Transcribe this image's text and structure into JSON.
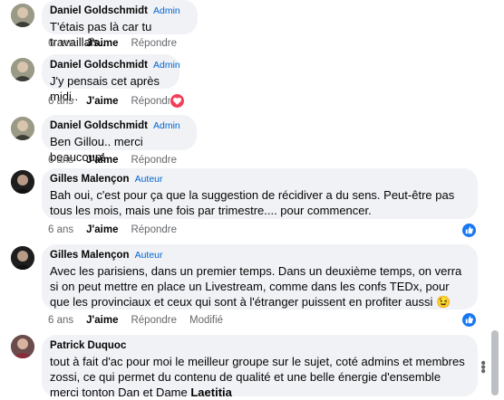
{
  "comments": [
    {
      "author": "Daniel Goldschmidt",
      "badge": "Admin",
      "text": "T'étais pas là car tu travaillais..",
      "time": "6 ans",
      "like": "J'aime",
      "reply": "Répondre",
      "edited": "",
      "reaction": ""
    },
    {
      "author": "Daniel Goldschmidt",
      "badge": "Admin",
      "text": "J'y pensais cet après midi..",
      "time": "6 ans",
      "like": "J'aime",
      "reply": "Répondre",
      "edited": "",
      "reaction": "love-icon"
    },
    {
      "author": "Daniel Goldschmidt",
      "badge": "Admin",
      "text": "Ben Gillou.. merci beaucoup!",
      "time": "6 ans",
      "like": "J'aime",
      "reply": "Répondre",
      "edited": "",
      "reaction": ""
    },
    {
      "author": "Gilles Malençon",
      "badge": "Auteur",
      "text": "Bah oui, c'est pour ça que la suggestion de récidiver a du sens. Peut-être pas tous les mois, mais une fois par trimestre.... pour commencer.",
      "time": "6 ans",
      "like": "J'aime",
      "reply": "Répondre",
      "edited": "",
      "reaction": "like-icon"
    },
    {
      "author": "Gilles Malençon",
      "badge": "Auteur",
      "text": "Avec les parisiens, dans un premier temps. Dans un deuxième temps, on verra si on peut mettre en place un Livestream, comme dans les confs TEDx, pour que les provinciaux et ceux qui sont à l'étranger puissent en profiter aussi 😉",
      "time": "6 ans",
      "like": "J'aime",
      "reply": "Répondre",
      "edited": "Modifié",
      "reaction": "like-icon"
    },
    {
      "author": "Patrick Duquoc",
      "badge": "",
      "text": "tout à fait d'ac pour moi le meilleur groupe sur le sujet, coté admins et membres zossi, ce qui permet du contenu de qualité et une belle énergie d'ensemble merci tonton Dan et Dame",
      "mention": "Laetitia",
      "time": "",
      "like": "",
      "reply": "",
      "edited": "",
      "reaction": ""
    }
  ],
  "colors": {
    "bubble": "#f0f2f5",
    "badge": "#0064d1",
    "meta": "#65676b",
    "love": "#f33e58",
    "like": "#1877f2"
  },
  "more_icon": "more-horizontal-icon"
}
